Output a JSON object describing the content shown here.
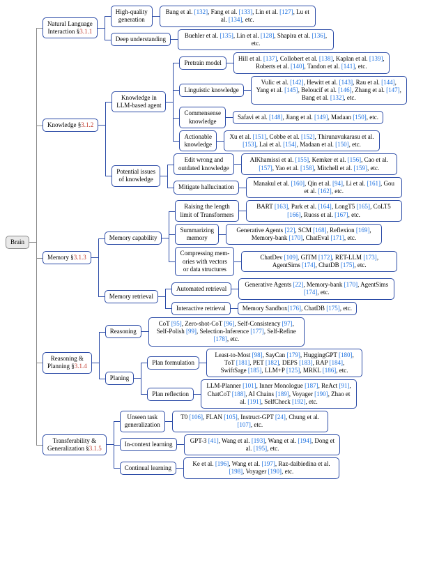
{
  "root": "Brain",
  "sections": [
    {
      "label_a": "Natural Language",
      "label_b": "Interaction §",
      "sect": "3.1.1",
      "children": [
        {
          "label": "High-quality\ngeneration",
          "refs": "Bang et al. [132], Fang et al. [133], Lin et al. [127], Lu et al. [134], etc."
        },
        {
          "label": "Deep understanding",
          "refs": "Buehler et al. [135], Lin et al. [128], Shapira et al. [136], etc."
        }
      ]
    },
    {
      "label_a": "Knowledge §",
      "sect": "3.1.2",
      "children": [
        {
          "group": "Knowledge in\nLLM-based agent",
          "items": [
            {
              "label": "Pretrain model",
              "refs": "Hill et al. [137], Collobert et al. [138], Kaplan et al. [139], Roberts et al. [140], Tandon et al. [141], etc."
            },
            {
              "label": "Linguistic knowledge",
              "refs": "Vulic et al. [142], Hewitt et al. [143], Rau et al. [144], Yang et al. [145], Beloucif et al. [146], Zhang et al. [147], Bang et al. [132], etc."
            },
            {
              "label": "Commensense\nknowledge",
              "refs": "Safavi et al. [148], Jiang et al. [149], Madaan [150], etc."
            },
            {
              "label": "Actionable\nknowledge",
              "refs": "Xu et al. [151], Cobbe et al. [152], Thirunavukarasu et al. [153], Lai et al. [154], Madaan et al. [150], etc."
            }
          ]
        },
        {
          "group": "Potential issues\nof knowledge",
          "items": [
            {
              "label": "Edit wrong and\noutdated knowledge",
              "refs": "AlKhamissi et al. [155], Kemker et al. [156], Cao et al. [157], Yao et al. [158], Mitchell et al. [159], etc."
            },
            {
              "label": "Mitigate hallucination",
              "refs": "Manakul et al. [160], Qin et al. [94], Li et al. [161], Gou et al. [162], etc."
            }
          ]
        }
      ]
    },
    {
      "label_a": "Memory §",
      "sect": "3.1.3",
      "children": [
        {
          "group": "Memory capability",
          "items": [
            {
              "label": "Raising the length\nlimit of Transformers",
              "refs": "BART [163], Park et al. [164], LongT5 [165], CoLT5 [166], Ruoss et al. [167], etc."
            },
            {
              "label": "Summarizing\nmemory",
              "refs": "Generative Agents [22], SCM [168], Reflexion [169], Memory-bank [170], ChatEval [171], etc."
            },
            {
              "label": "Compressing mem-\nories with vectors\nor data structures",
              "refs": "ChatDev [109], GITM [172], RET-LLM [173], AgentSims [174], ChatDB [175], etc."
            }
          ]
        },
        {
          "group": "Memory retrieval",
          "items": [
            {
              "label": "Automated retrieval",
              "refs": "Generative Agents [22], Memory-bank [170], AgentSims [174], etc."
            },
            {
              "label": "Interactive retrieval",
              "refs": "Memory Sandbox[176], ChatDB [175], etc."
            }
          ]
        }
      ]
    },
    {
      "label_a": "Reasoning &",
      "label_b": "Planning §",
      "sect": "3.1.4",
      "children": [
        {
          "label": "Reasoning",
          "refs": "CoT [95], Zero-shot-CoT [96], Self-Consistency [97], Self-Polish [99], Selection-Inference [177], Self-Refine [178], etc."
        },
        {
          "group": "Planing",
          "items": [
            {
              "label": "Plan formulation",
              "refs": "Least-to-Most [98], SayCan [179], HuggingGPT [180], ToT [181], PET [182], DEPS [183], RAP [184], SwiftSage [185], LLM+P [125], MRKL [186], etc."
            },
            {
              "label": "Plan reflection",
              "refs": "LLM-Planner [101], Inner Monologue [187], ReAct [91], ChatCoT [188], AI Chains [189], Voyager [190], Zhao et al. [191], SelfCheck [192], etc."
            }
          ]
        }
      ]
    },
    {
      "label_a": "Transferability &",
      "label_b": "Generalization §",
      "sect": "3.1.5",
      "children": [
        {
          "label": "Unseen task\ngeneralization",
          "refs": "T0 [106], FLAN [105], Instruct-GPT [24], Chung et al. [107], etc."
        },
        {
          "label": "In-context learning",
          "refs": "GPT-3 [41], Wang et al. [193], Wang et al. [194], Dong et al. [195], etc."
        },
        {
          "label": "Continual learning",
          "refs": "Ke et al. [196], Wang et al. [197], Raz-daibiedina et al. [198], Voyager [190], etc."
        }
      ]
    }
  ]
}
